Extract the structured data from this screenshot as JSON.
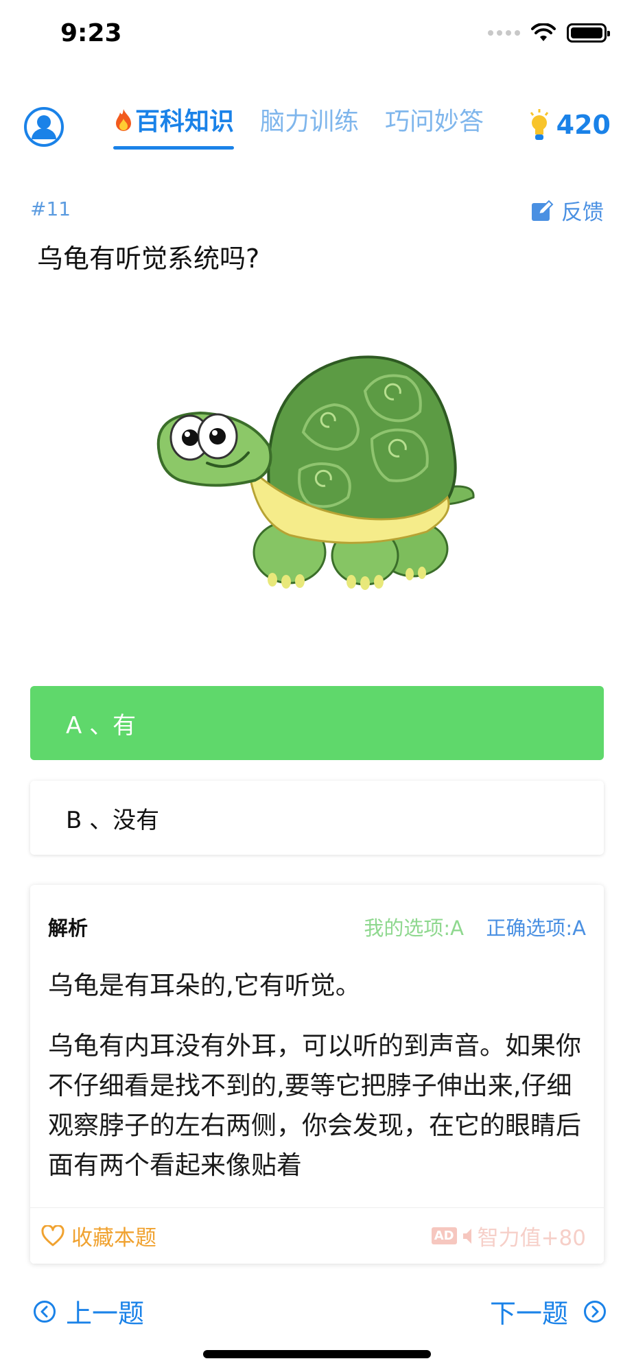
{
  "status_bar": {
    "time": "9:23"
  },
  "tabs": [
    {
      "label": "百科知识",
      "active": true
    },
    {
      "label": "脑力训练",
      "active": false
    },
    {
      "label": "巧问妙答",
      "active": false
    }
  ],
  "score": {
    "value": "420",
    "icon": "lightbulb-icon"
  },
  "question": {
    "number": "#11",
    "feedback_label": "反馈",
    "text": "乌龟有听觉系统吗?"
  },
  "options": [
    {
      "label": "A 、有",
      "state": "selected-correct"
    },
    {
      "label": "B 、没有",
      "state": "default"
    }
  ],
  "analysis": {
    "title": "解析",
    "my_choice": "我的选项:A",
    "correct_choice": "正确选项:A",
    "summary": "乌龟是有耳朵的,它有听觉。",
    "detail": "乌龟有内耳没有外耳，可以听的到声音。如果你不仔细看是找不到的,要等它把脖子伸出来,仔细观察脖子的左右两侧，你会发现，在它的眼睛后面有两个看起来像贴着",
    "collect_label": "收藏本题",
    "ad_badge": "AD",
    "reward_label": "智力值+80"
  },
  "navigation": {
    "prev_label": "上一题",
    "next_label": "下一题"
  },
  "colors": {
    "primary": "#1a82e8",
    "correct": "#5fd86b",
    "collect": "#f0a230"
  }
}
